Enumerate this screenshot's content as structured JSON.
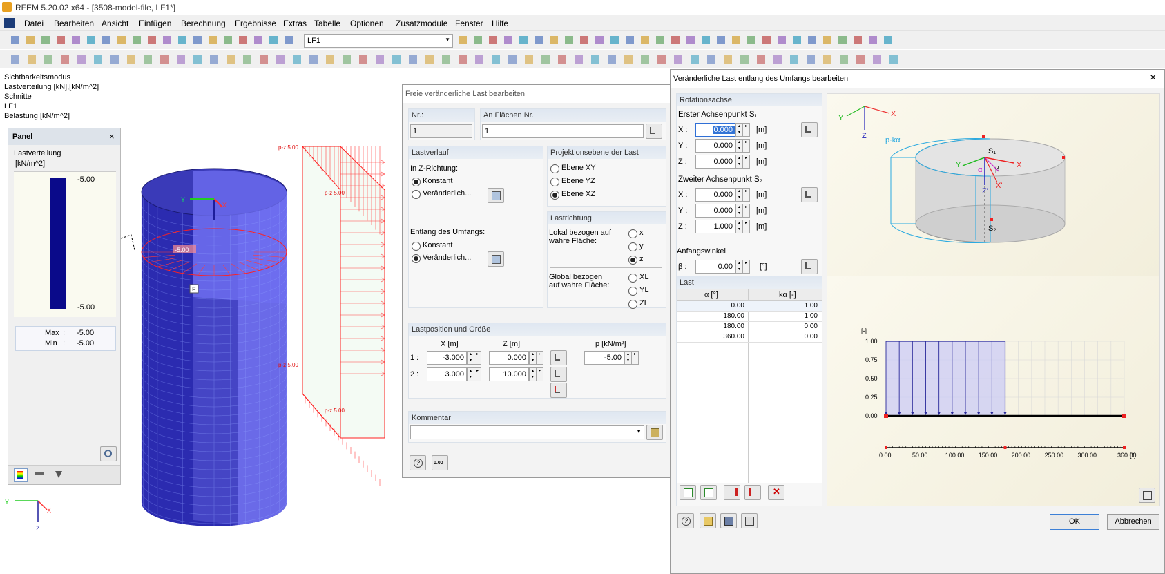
{
  "window": {
    "title": "RFEM 5.20.02 x64 - [3508-model-file, LF1*]"
  },
  "menu": [
    "Datei",
    "Bearbeiten",
    "Ansicht",
    "Einfügen",
    "Berechnung",
    "Ergebnisse",
    "Extras",
    "Tabelle",
    "Optionen",
    "Zusatzmodule",
    "Fenster",
    "Hilfe"
  ],
  "toolbar": {
    "loadcase": "LF1"
  },
  "canvas": {
    "info": [
      "Sichtbarkeitsmodus",
      "Lastverteilung [kN],[kN/m^2]",
      "Schnitte",
      "LF1",
      "Belastung [kN/m^2]"
    ],
    "cyl_label": "-5.00",
    "load_labels": [
      "p-z 5.00",
      "p-z 5.00",
      "p-z 5.00",
      "p-z 5.00"
    ],
    "node_label": "F",
    "axes": {
      "x": "X",
      "y": "Y",
      "z": "Z"
    }
  },
  "panel": {
    "title": "Panel",
    "heading": "Lastverteilung",
    "unit": "[kN/m^2]",
    "top": "-5.00",
    "bottom": "-5.00",
    "max_label": "Max",
    "max_value": "-5.00",
    "min_label": "Min",
    "min_value": "-5.00"
  },
  "dlg1": {
    "title": "Freie veränderliche Last bearbeiten",
    "nr_label": "Nr.:",
    "nr_value": "1",
    "flaechen_label": "An Flächen Nr.",
    "flaechen_value": "1",
    "lastverlauf": "Lastverlauf",
    "z_richtung": "In Z-Richtung:",
    "konstant": "Konstant",
    "veraenderlich": "Veränderlich...",
    "umfang": "Entlang des Umfangs:",
    "projektion": "Projektionsebene der Last",
    "ebenen": [
      "Ebene XY",
      "Ebene YZ",
      "Ebene XZ"
    ],
    "lastrichtung": "Lastrichtung",
    "lokal": "Lokal bezogen auf wahre Fläche:",
    "lokal_opts": [
      "x",
      "y",
      "z"
    ],
    "global": "Global bezogen auf wahre Fläche:",
    "global_opts": [
      "XL",
      "YL",
      "ZL"
    ],
    "lastpos": "Lastposition und Größe",
    "col_x": "X  [m]",
    "col_z": "Z  [m]",
    "col_p": "p  [kN/m²]",
    "row1": {
      "n": "1 :",
      "x": "-3.000",
      "z": "0.000",
      "p": "-5.00"
    },
    "row2": {
      "n": "2 :",
      "x": "3.000",
      "z": "10.000"
    },
    "kommentar": "Kommentar",
    "calc_btn": "0.00"
  },
  "dlg2": {
    "title": "Veränderliche Last entlang des Umfangs bearbeiten",
    "rot": "Rotationsachse",
    "s1": "Erster Achsenpunkt S₁",
    "s2": "Zweiter Achsenpunkt S₂",
    "s1_vals": [
      "0.000",
      "0.000",
      "0.000"
    ],
    "s2_vals": [
      "0.000",
      "0.000",
      "1.000"
    ],
    "coord_labels": [
      "X :",
      "Y :",
      "Z :"
    ],
    "unit_m": "[m]",
    "anfangswinkel": "Anfangswinkel",
    "beta_label": "β :",
    "beta_value": "0.00",
    "beta_unit": "[°]",
    "last": "Last",
    "col_alpha": "α [°]",
    "col_k": "kα [-]",
    "rows": [
      [
        "0.00",
        "1.00"
      ],
      [
        "180.00",
        "1.00"
      ],
      [
        "180.00",
        "0.00"
      ],
      [
        "360.00",
        "0.00"
      ]
    ],
    "ok": "OK",
    "cancel": "Abbrechen",
    "diagram_labels": {
      "pk": "p·kα",
      "s1": "S₁",
      "s2": "S₂",
      "x": "X",
      "y": "Y",
      "z": "Z",
      "alpha": "α",
      "beta": "β",
      "xp": "X'",
      "zp": "Z'"
    }
  },
  "chart_data": {
    "type": "area",
    "ylabel": "[-]",
    "xunit": "[°]",
    "x": [
      0,
      180,
      180,
      360
    ],
    "y": [
      1.0,
      1.0,
      0.0,
      0.0
    ],
    "xlim": [
      0,
      360
    ],
    "ylim": [
      0,
      1
    ],
    "xticks": [
      "0.00",
      "50.00",
      "100.00",
      "150.00",
      "200.00",
      "250.00",
      "300.00",
      "360.00"
    ],
    "yticks": [
      "1.00",
      "0.75",
      "0.50",
      "0.25",
      "0.00"
    ],
    "grid": true
  }
}
